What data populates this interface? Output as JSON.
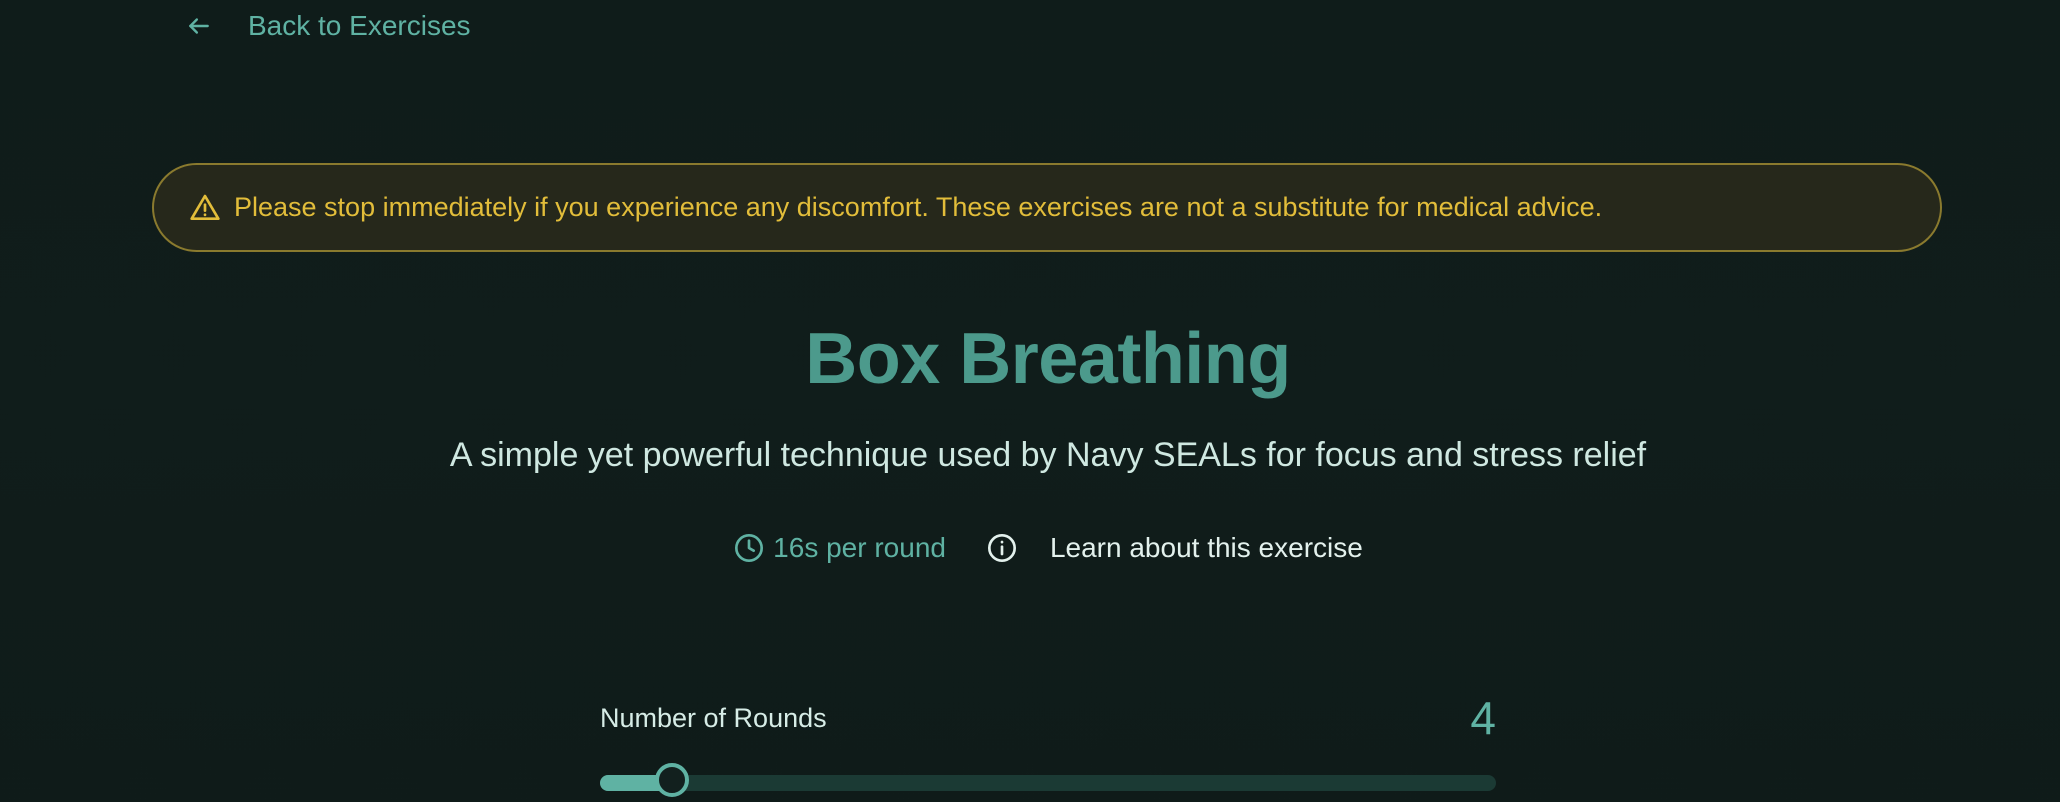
{
  "nav": {
    "back_label": "Back to Exercises"
  },
  "warning": {
    "text": "Please stop immediately if you experience any discomfort. These exercises are not a substitute for medical advice."
  },
  "exercise": {
    "title": "Box Breathing",
    "subtitle": "A simple yet powerful technique used by Navy SEALs for focus and stress relief",
    "duration": "16s per round",
    "learn_label": "Learn about this exercise"
  },
  "rounds": {
    "label": "Number of Rounds",
    "value": "4",
    "fill_fraction": 0.08
  },
  "colors": {
    "accent": "#5fb2a3",
    "title": "#4c9a8c",
    "warning_text": "#e2bd3a",
    "warning_border": "#8a7a2e",
    "background": "#101d1b"
  },
  "icons": {
    "back": "arrow-left-icon",
    "warning": "warning-triangle-icon",
    "duration": "clock-icon",
    "info": "info-icon"
  }
}
